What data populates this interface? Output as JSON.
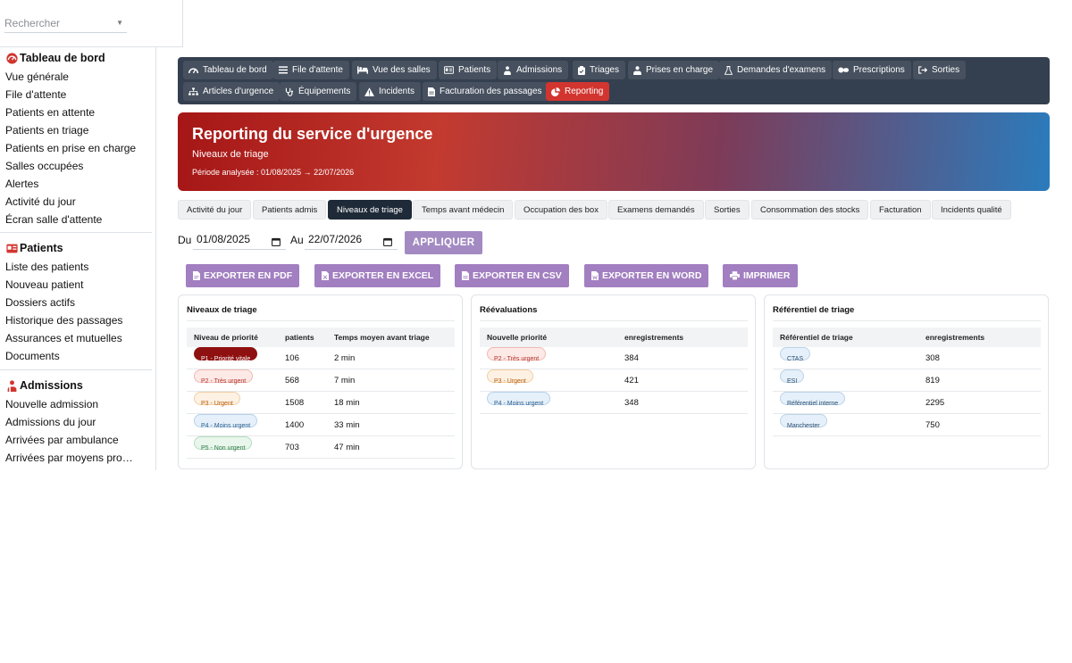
{
  "search": {
    "placeholder": "Rechercher"
  },
  "sidebar": {
    "sections": [
      {
        "title": "Tableau de bord",
        "items": [
          "Vue générale",
          "File d'attente",
          "Patients en attente",
          "Patients en triage",
          "Patients en prise en charge",
          "Salles occupées",
          "Alertes",
          "Activité du jour",
          "Écran salle d'attente"
        ]
      },
      {
        "title": "Patients",
        "items": [
          "Liste des patients",
          "Nouveau patient",
          "Dossiers actifs",
          "Historique des passages",
          "Assurances et mutuelles",
          "Documents"
        ]
      },
      {
        "title": "Admissions",
        "items": [
          "Nouvelle admission",
          "Admissions du jour",
          "Arrivées par ambulance",
          "Arrivées par moyens pro…"
        ]
      }
    ]
  },
  "navbar": {
    "row1": [
      "Tableau de bord",
      "File d'attente",
      "Vue des salles",
      "Patients",
      "Admissions",
      "Triages",
      "Prises en charge",
      "Demandes d'examens",
      "Prescriptions",
      "Sorties"
    ],
    "row2": [
      "Articles d'urgence",
      "Équipements",
      "Incidents",
      "Facturation des passages",
      "Reporting"
    ],
    "active": "Reporting",
    "accent": "#d2352f"
  },
  "hero": {
    "title": "Reporting du service d'urgence",
    "subtitle": "Niveaux de triage",
    "period": "Période analysée : 01/08/2025 → 22/07/2026"
  },
  "tabs": [
    "Activité du jour",
    "Patients admis",
    "Niveaux de triage",
    "Temps avant médecin",
    "Occupation des box",
    "Examens demandés",
    "Sorties",
    "Consommation des stocks",
    "Facturation",
    "Incidents qualité"
  ],
  "filters": {
    "from_label": "Du",
    "from_value": "01/08/2025",
    "to_label": "Au",
    "to_value": "22/07/2026",
    "apply": "APPLIQUER"
  },
  "exports": [
    "EXPORTER EN PDF",
    "EXPORTER EN EXCEL",
    "EXPORTER EN CSV",
    "EXPORTER EN WORD",
    "IMPRIMER"
  ],
  "cards": {
    "levels": {
      "title": "Niveaux de triage",
      "headers": [
        "Niveau de priorité",
        "patients",
        "Temps moyen avant triage"
      ],
      "rows": [
        {
          "level": "P1 - Priorité vitale",
          "patients": "106",
          "time": "2 min"
        },
        {
          "level": "P2 - Très urgent",
          "patients": "568",
          "time": "7 min"
        },
        {
          "level": "P3 - Urgent",
          "patients": "1508",
          "time": "18 min"
        },
        {
          "level": "P4 - Moins urgent",
          "patients": "1400",
          "time": "33 min"
        },
        {
          "level": "P5 - Non urgent",
          "patients": "703",
          "time": "47 min"
        }
      ]
    },
    "reevals": {
      "title": "Réévaluations",
      "headers": [
        "Nouvelle priorité",
        "enregistrements"
      ],
      "rows": [
        {
          "priority": "P2 - Très urgent",
          "count": "384"
        },
        {
          "priority": "P3 - Urgent",
          "count": "421"
        },
        {
          "priority": "P4 - Moins urgent",
          "count": "348"
        }
      ]
    },
    "referentials": {
      "title": "Référentiel de triage",
      "headers": [
        "Référentiel de triage",
        "enregistrements"
      ],
      "rows": [
        {
          "name": "CTAS",
          "count": "308"
        },
        {
          "name": "ESI",
          "count": "819"
        },
        {
          "name": "Référentiel interne",
          "count": "2295"
        },
        {
          "name": "Manchester",
          "count": "750"
        }
      ]
    }
  }
}
